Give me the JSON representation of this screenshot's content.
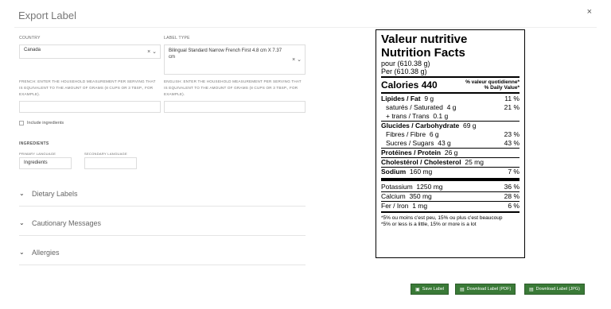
{
  "dialog": {
    "title": "Export Label",
    "close": "×"
  },
  "form": {
    "country_label": "COUNTRY",
    "country_value": "Canada",
    "label_type_label": "LABEL TYPE",
    "label_type_value": "Bilingual Standard Narrow French First 4.8 cm X 7.37 cm",
    "french_hint": "FRENCH: ENTER THE HOUSEHOLD MEASUREMENT PER SERVING THAT IS EQUIVALENT TO THE AMOUNT OF GRAMS (8 CUPS OR 3 TBSP., FOR EXAMPLE).",
    "english_hint": "ENGLISH: ENTER THE HOUSEHOLD MEASUREMENT PER SERVING THAT IS EQUIVALENT TO THE AMOUNT OF GRAMS (8 CUPS OR 3 TBSP., FOR EXAMPLE).",
    "include_ingredients": "Include ingredients",
    "ingredients_heading": "INGREDIENTS",
    "primary_language_label": "PRIMARY LANGUAGE",
    "primary_language_value": "Ingredients",
    "secondary_language_label": "SECONDARY LANGUAGE",
    "secondary_language_value": "",
    "clear_icon": "×",
    "chevron_icon": "⌄"
  },
  "accordions": [
    "Dietary Labels",
    "Cautionary Messages",
    "Allergies"
  ],
  "buttons": {
    "save": "Save Label",
    "pdf": "Download Label (PDF)",
    "jpg": "Download Label (JPG)"
  },
  "nutrition": {
    "title_fr": "Valeur nutritive",
    "title_en": "Nutrition Facts",
    "serving_fr": "pour   (610.38 g)",
    "serving_en": "Per   (610.38 g)",
    "calories_label": "Calories",
    "calories_value": "440",
    "dv_header_fr": "% valeur quotidienne*",
    "dv_header_en": "% Daily Value*",
    "rows": [
      {
        "label": "Lipides / Fat",
        "amount": "9 g",
        "dv": "11 %",
        "bold": true
      },
      {
        "label": "saturés / Saturated",
        "amount": "4 g",
        "dv": "21 %",
        "sub": true
      },
      {
        "label": "+ trans / Trans",
        "amount": "0.1 g",
        "dv": "",
        "sub": true
      },
      {
        "label": "Glucides / Carbohydrate",
        "amount": "69 g",
        "dv": "",
        "bold": true
      },
      {
        "label": "Fibres / Fibre",
        "amount": "6 g",
        "dv": "23 %",
        "sub": true
      },
      {
        "label": "Sucres / Sugars",
        "amount": "43 g",
        "dv": "43 %",
        "sub": true
      },
      {
        "label": "Protéines / Protein",
        "amount": "26 g",
        "dv": "",
        "bold": true
      },
      {
        "label": "Cholestérol / Cholesterol",
        "amount": "25 mg",
        "dv": "",
        "bold": true
      },
      {
        "label": "Sodium",
        "amount": "160 mg",
        "dv": "7 %",
        "bold": true
      },
      {
        "label": "Potassium",
        "amount": "1250 mg",
        "dv": "36 %"
      },
      {
        "label": "Calcium",
        "amount": "350 mg",
        "dv": "28 %"
      },
      {
        "label": "Fer / Iron",
        "amount": "1 mg",
        "dv": "6 %"
      }
    ],
    "foot_fr": "*5% ou moins c'est peu, 15% ou plus c'est beaucoup",
    "foot_en": "*5% or less is a little, 15% or more is a lot"
  }
}
